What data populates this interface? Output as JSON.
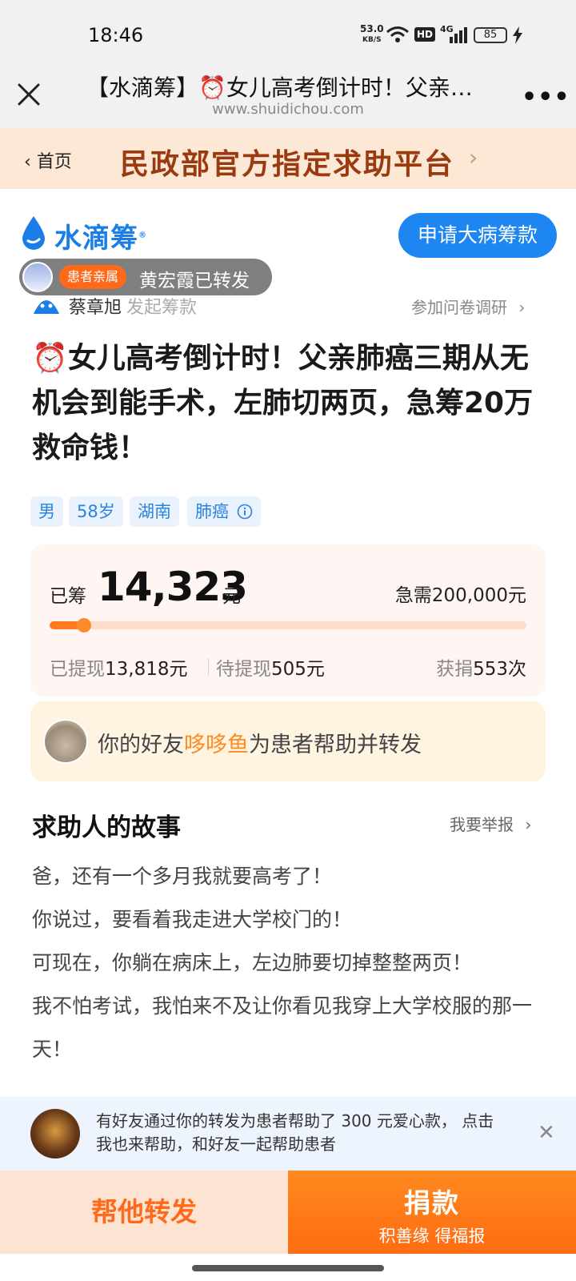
{
  "status_bar": {
    "time": "18:46",
    "net_speed_value": "53.0",
    "net_speed_unit": "KB/S",
    "hd_badge": "HD",
    "network_type": "4G",
    "battery": "85"
  },
  "title_bar": {
    "title": "【水滴筹】⏰女儿高考倒计时！父亲…",
    "url": "www.shuidichou.com"
  },
  "banner": {
    "back_label": "首页",
    "text": "民政部官方指定求助平台"
  },
  "logo": {
    "text": "水滴筹",
    "registered": "®",
    "brand_color": "#1a7ee6"
  },
  "apply_button": "申请大病筹款",
  "share_pill": {
    "relation": "患者亲属",
    "text": "黄宏霞已转发"
  },
  "initiator": {
    "name": "蔡章旭",
    "action": "发起筹款",
    "survey_link": "参加问卷调研"
  },
  "headline": "⏰女儿高考倒计时！父亲肺癌三期从无机会到能手术，左肺切两页，急筹20万救命钱！",
  "tags": [
    "男",
    "58岁",
    "湖南",
    "肺癌"
  ],
  "fund": {
    "raised_label": "已筹",
    "raised_amount": "14,323",
    "raised_unit": "元",
    "needed_text": "急需200,000元",
    "progress_fraction": 0.0716,
    "withdrawn_label": "已提现",
    "withdrawn_value": "13,818元",
    "pending_label": "待提现",
    "pending_value": "505元",
    "donations_label": "获捐",
    "donations_value": "553次",
    "accent_color": "#ff7a20"
  },
  "friend": {
    "prefix": "你的好友",
    "name": "哆哆鱼",
    "suffix": "为患者帮助并转发"
  },
  "story": {
    "title": "求助人的故事",
    "report_link": "我要举报",
    "paragraphs": [
      "爸，还有一个多月我就要高考了！",
      "你说过，要看着我走进大学校门的！",
      "可现在，你躺在病床上，左边肺要切掉整整两页！",
      "我不怕考试，我怕来不及让你看见我穿上大学校服的那一天！"
    ]
  },
  "notice": {
    "text": "有好友通过你的转发为患者帮助了 300 元爱心款， 点击我也来帮助，和好友一起帮助患者"
  },
  "bottom_bar": {
    "share_label": "帮他转发",
    "donate_label": "捐款",
    "donate_sub": "积善缘 得福报"
  }
}
